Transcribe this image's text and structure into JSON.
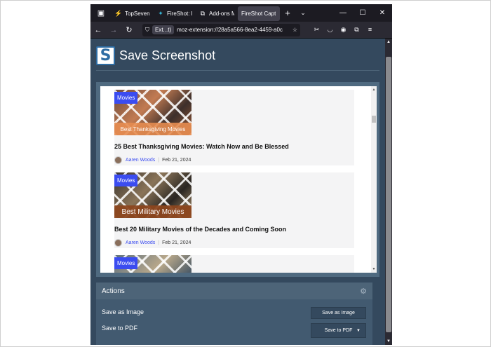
{
  "tabs": [
    {
      "title": "TopSevenRe",
      "active": false
    },
    {
      "title": "FireShot: Fu",
      "active": false
    },
    {
      "title": "Add-ons M",
      "active": false
    },
    {
      "title": "FireShot Capt",
      "active": true
    }
  ],
  "navbar": {
    "ext_label": "Ext...t)",
    "url": "moz-extension://28a5a566-8ea2-4459-a0c"
  },
  "app": {
    "logo_letter": "S",
    "title": "Save Screenshot"
  },
  "preview": {
    "cards": [
      {
        "category": "Movies",
        "banner": "Best Thanksgiving Movies",
        "headline": "25 Best Thanksgiving Movies: Watch Now and Be Blessed",
        "author": "Aaren Woods",
        "date": "Feb 21, 2024"
      },
      {
        "category": "Movies",
        "banner": "Best Military Movies",
        "headline": "Best 20 Military Movies of the Decades and Coming Soon",
        "author": "Aaren Woods",
        "date": "Feb 21, 2024"
      },
      {
        "category": "Movies",
        "banner": "",
        "headline": "",
        "author": "",
        "date": ""
      }
    ]
  },
  "actions": {
    "title": "Actions",
    "items": [
      {
        "label": "Save as Image",
        "button": "Save as Image"
      },
      {
        "label": "Save to PDF",
        "button": "Save to PDF"
      }
    ]
  },
  "colors": {
    "page_bg": "#34495e",
    "category_badge": "#3b4cf0",
    "author_link": "#3b4cf0"
  }
}
